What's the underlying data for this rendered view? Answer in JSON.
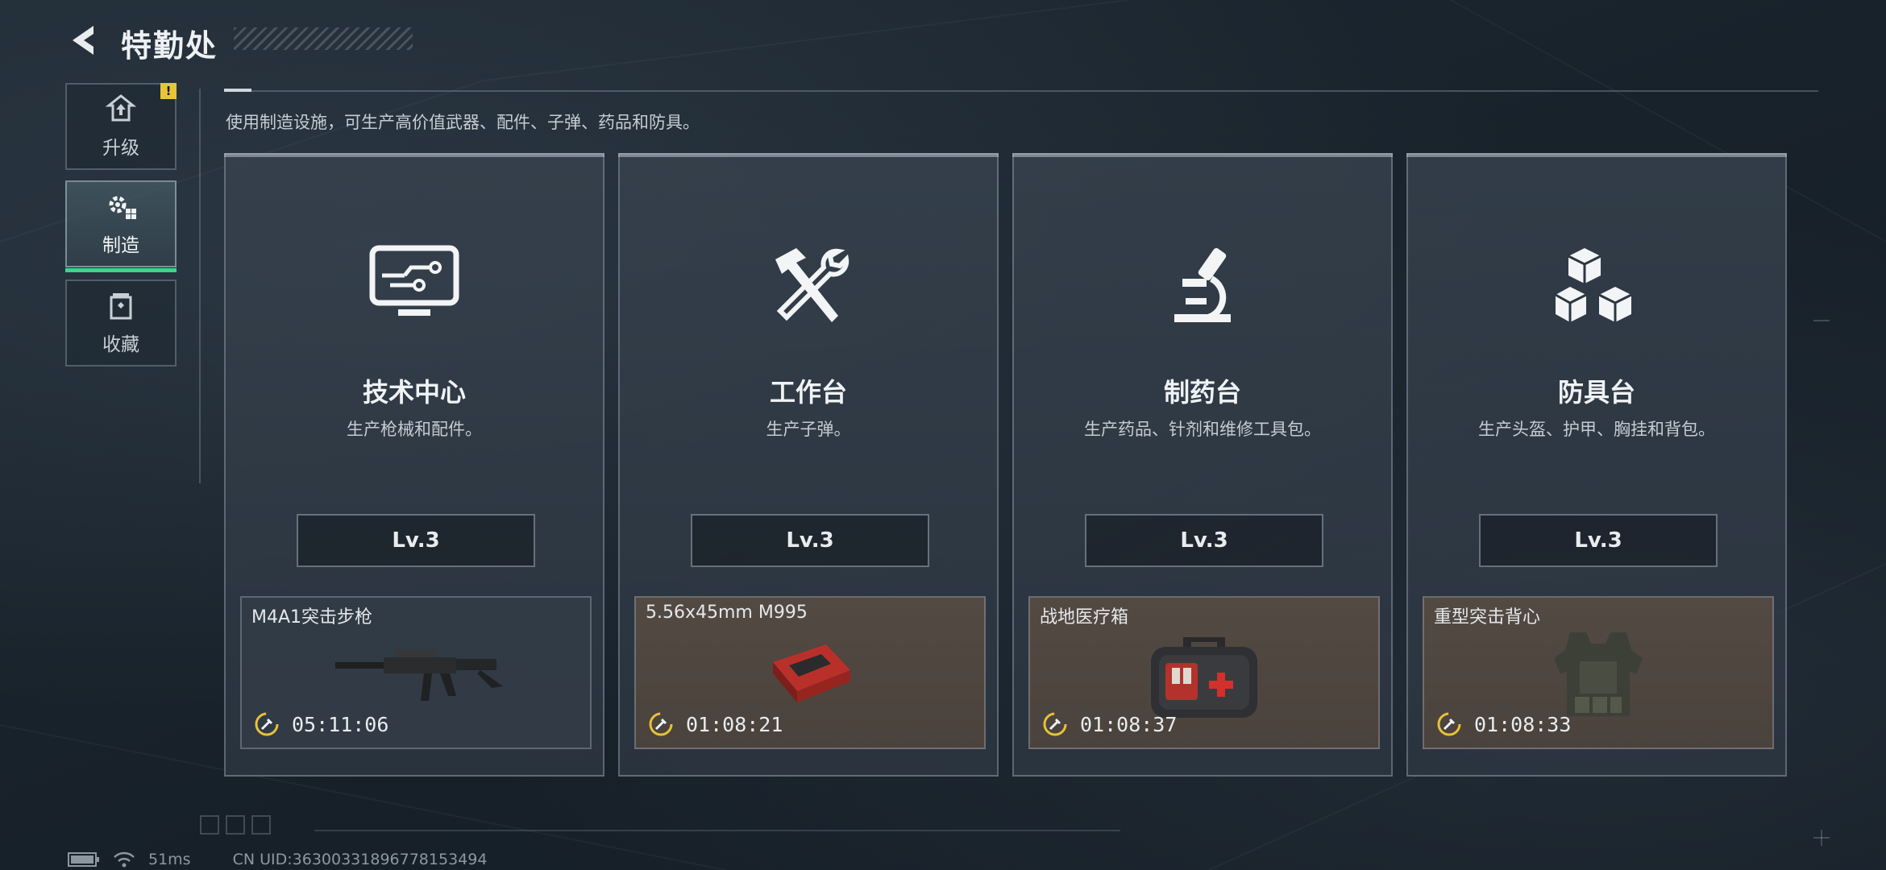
{
  "header": {
    "title": "特勤处"
  },
  "sidebar": {
    "items": [
      {
        "label": "升级",
        "icon": "upgrade-icon",
        "active": false,
        "warning": "!"
      },
      {
        "label": "制造",
        "icon": "crafting-gear-icon",
        "active": true
      },
      {
        "label": "收藏",
        "icon": "collection-icon",
        "active": false
      }
    ]
  },
  "main": {
    "description": "使用制造设施，可生产高价值武器、配件、子弹、药品和防具。",
    "stations": [
      {
        "name": "技术中心",
        "subtitle": "生产枪械和配件。",
        "level": "Lv.3",
        "icon": "monitor-circuit-icon",
        "item": {
          "name": "M4A1突击步枪",
          "timer": "05:11:06",
          "style": "gray",
          "image": "rifle-image"
        }
      },
      {
        "name": "工作台",
        "subtitle": "生产子弹。",
        "level": "Lv.3",
        "icon": "hammer-wrench-icon",
        "item": {
          "name": "5.56x45mm M995",
          "timer": "01:08:21",
          "style": "brown",
          "image": "ammo-box-image"
        }
      },
      {
        "name": "制药台",
        "subtitle": "生产药品、针剂和维修工具包。",
        "level": "Lv.3",
        "icon": "microscope-icon",
        "item": {
          "name": "战地医疗箱",
          "timer": "01:08:37",
          "style": "brown",
          "image": "medkit-image"
        }
      },
      {
        "name": "防具台",
        "subtitle": "生产头盔、护甲、胸挂和背包。",
        "level": "Lv.3",
        "icon": "cubes-icon",
        "item": {
          "name": "重型突击背心",
          "timer": "01:08:33",
          "style": "brown",
          "image": "armor-vest-image"
        }
      }
    ]
  },
  "footer": {
    "ping": "51ms",
    "uid": "CN UID:36300331896778153494"
  },
  "colors": {
    "accent_green": "#3fd48a",
    "warning_yellow": "#e9c43a",
    "timer_yellow": "#e6c23a"
  }
}
